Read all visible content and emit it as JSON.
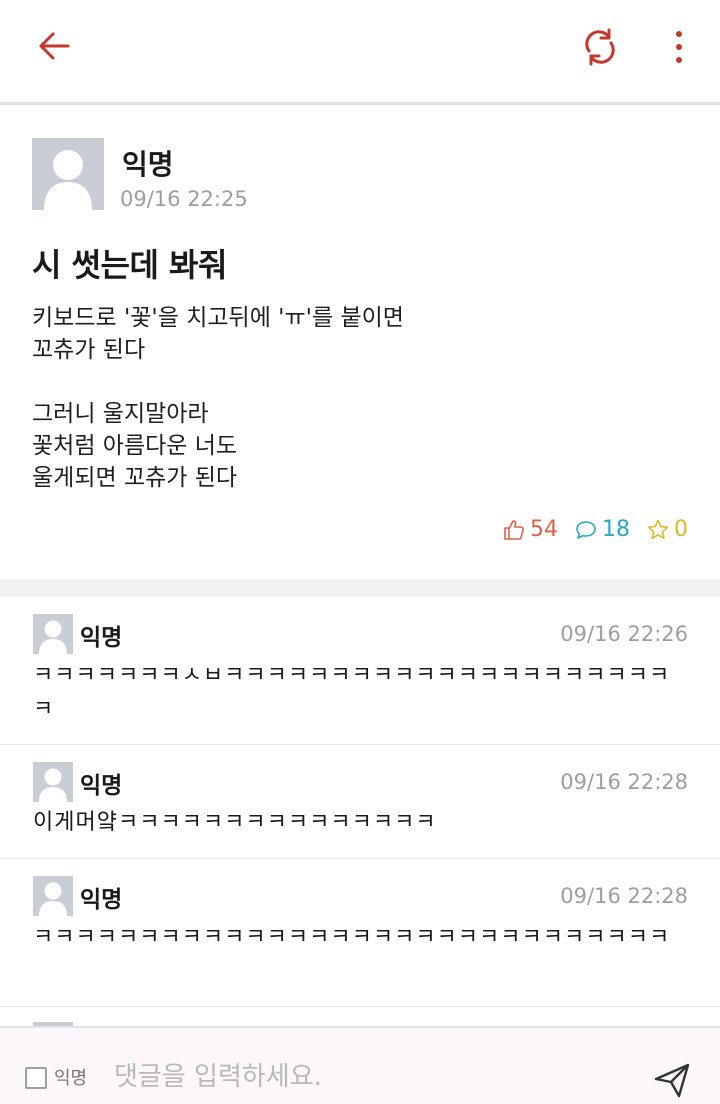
{
  "colors": {
    "accent": "#c0392b",
    "like": "#d9634a",
    "comment": "#2aa8c4",
    "star": "#e0b82b"
  },
  "post": {
    "author": "익명",
    "time": "09/16 22:25",
    "title": "시 썻는데 봐줘",
    "body": "키보드로 '꽃'을 치고뒤에 'ㅠ'를 붙이면\n꼬츄가 된다\n\n그러니 울지말아라\n꽃처럼 아름다운 너도\n울게되면 꼬츄가 된다",
    "likes": "54",
    "comments": "18",
    "stars": "0"
  },
  "comments": [
    {
      "author": "익명",
      "time": "09/16 22:26",
      "text": "ㅋㅋㅋㅋㅋㅋㅋㅅㅂㅋㅋㅋㅋㅋㅋㅋㅋㅋㅋㅋㅋㅋㅋㅋㅋㅋㅋㅋㅋㅋㅋ"
    },
    {
      "author": "익명",
      "time": "09/16 22:28",
      "text": "이게머얔ㅋㅋㅋㅋㅋㅋㅋㅋㅋㅋㅋㅋㅋㅋㅋ"
    },
    {
      "author": "익명",
      "time": "09/16 22:28",
      "text": "ㅋㅋㅋㅋㅋㅋㅋㅋㅋㅋㅋㅋㅋㅋㅋㅋㅋㅋㅋㅋㅋㅋㅋㅋㅋㅋㅋㅋㅋㅋ"
    }
  ],
  "composer": {
    "anon_label": "익명",
    "placeholder": "댓글을 입력하세요."
  }
}
